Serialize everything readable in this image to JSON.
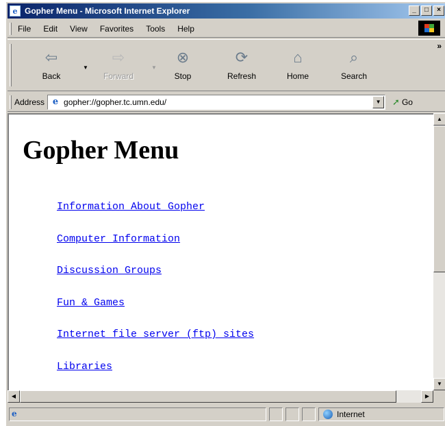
{
  "window": {
    "title": "Gopher Menu - Microsoft Internet Explorer",
    "title_icon": "ie-icon",
    "buttons": {
      "minimize": "_",
      "maximize": "□",
      "close": "×"
    }
  },
  "menubar": {
    "items": [
      {
        "label": "File"
      },
      {
        "label": "Edit"
      },
      {
        "label": "View"
      },
      {
        "label": "Favorites"
      },
      {
        "label": "Tools"
      },
      {
        "label": "Help"
      }
    ]
  },
  "toolbar": {
    "back": {
      "label": "Back",
      "icon": "back-arrow-icon"
    },
    "forward": {
      "label": "Forward",
      "icon": "forward-arrow-icon",
      "disabled": true
    },
    "stop": {
      "label": "Stop",
      "icon": "stop-icon"
    },
    "refresh": {
      "label": "Refresh",
      "icon": "refresh-icon"
    },
    "home": {
      "label": "Home",
      "icon": "home-icon"
    },
    "search": {
      "label": "Search",
      "icon": "search-icon"
    }
  },
  "address": {
    "label": "Address",
    "value": "gopher://gopher.tc.umn.edu/",
    "go_label": "Go"
  },
  "page": {
    "title": "Gopher Menu",
    "links": [
      "Information About Gopher",
      "Computer Information",
      "Discussion Groups",
      "Fun & Games",
      "Internet file server (ftp) sites",
      "Libraries"
    ]
  },
  "status": {
    "zone": "Internet"
  },
  "colors": {
    "titlebar_start": "#0a246a",
    "titlebar_end": "#a6caf0",
    "chrome": "#d4d0c8",
    "link": "#0000ee"
  }
}
